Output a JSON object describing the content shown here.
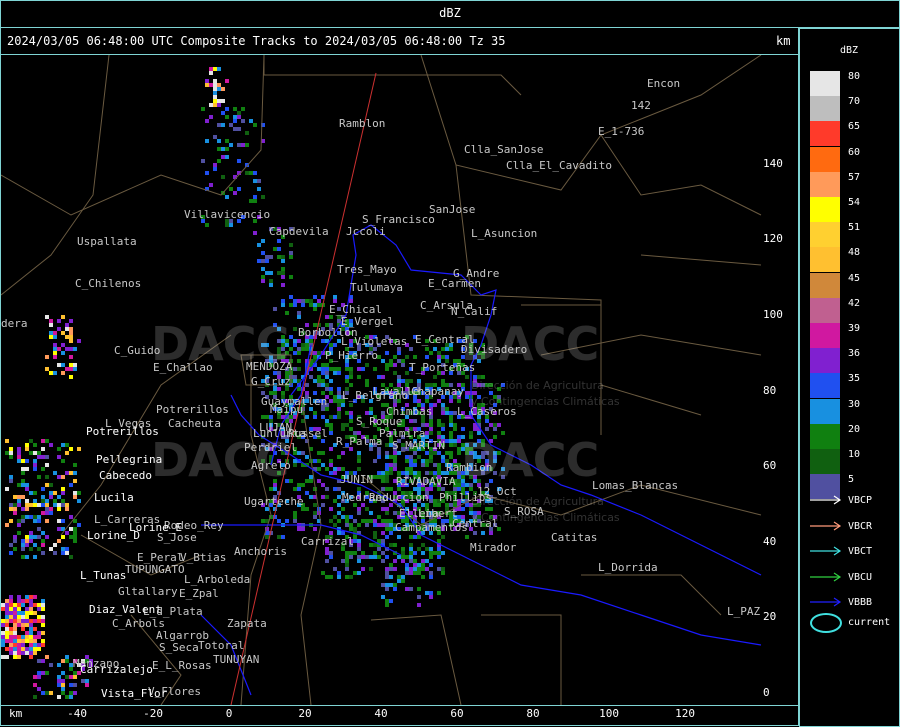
{
  "header": {
    "units": "dBZ"
  },
  "title_line": {
    "text": "2024/03/05 06:48:00 UTC Composite Tracks to 2024/03/05 06:48:00 Tz 35",
    "km": "km"
  },
  "axes": {
    "x_label": "km",
    "x_ticks": [
      "-40",
      "-20",
      "0",
      "20",
      "40",
      "60",
      "80",
      "100",
      "120"
    ],
    "y_ticks": [
      "140",
      "120",
      "100",
      "80",
      "60",
      "40",
      "20",
      "0"
    ],
    "x_range_km": [
      -60,
      140
    ],
    "y_range_km": [
      -20,
      150
    ]
  },
  "legend": {
    "title": "dBZ",
    "levels": [
      {
        "v": "80",
        "c": "#e6e6e6"
      },
      {
        "v": "70",
        "c": "#bebebe"
      },
      {
        "v": "65",
        "c": "#ff3a2a"
      },
      {
        "v": "60",
        "c": "#ff6a10"
      },
      {
        "v": "57",
        "c": "#ff9a5a"
      },
      {
        "v": "54",
        "c": "#ffff00"
      },
      {
        "v": "51",
        "c": "#ffd030"
      },
      {
        "v": "48",
        "c": "#ffc030"
      },
      {
        "v": "45",
        "c": "#d0883a"
      },
      {
        "v": "42",
        "c": "#c06090"
      },
      {
        "v": "39",
        "c": "#d018a0"
      },
      {
        "v": "36",
        "c": "#8020d0"
      },
      {
        "v": "35",
        "c": "#2050f0"
      },
      {
        "v": "30",
        "c": "#1890e0"
      },
      {
        "v": "20",
        "c": "#108010"
      },
      {
        "v": "10",
        "c": "#106010"
      },
      {
        "v": "5",
        "c": "#5050a0"
      }
    ],
    "tracks": [
      {
        "label": "VBCP",
        "c": "#ffffff"
      },
      {
        "label": "VBCR",
        "c": "#ff9a7a"
      },
      {
        "label": "VBCT",
        "c": "#40e0e0"
      },
      {
        "label": "VBCU",
        "c": "#30d040"
      },
      {
        "label": "VBBB",
        "c": "#2020ff"
      }
    ],
    "current_label": "current"
  },
  "watermark": {
    "logo": "DACC",
    "sub1": "Dirección de Agricultura",
    "sub2": "y Contingencias Climáticas"
  },
  "places_gray": [
    "Ramblon",
    "Encon",
    "E_1-736",
    "Clla_SanJose",
    "Clla_El_Cavadito",
    "Villavicencio",
    "SanJose",
    "Uspallata",
    "Capdevila",
    "Jccoli",
    "S_Francisco",
    "L_Asuncion",
    "Tres_Mayo",
    "G_Andre",
    "C_Chilenos",
    "Tulumaya",
    "E_Carmen",
    "E_Chical",
    "C_Arsula",
    "N_Calif",
    "Borbollon",
    "E_Vergel",
    "C_Guido",
    "L_Violetas",
    "E_Central",
    "Divisadero",
    "E_Challao",
    "P_Hierro",
    "T_Porteñas",
    "G_Cruz",
    "L_Vegas",
    "Potrerillos",
    "Cacheuta",
    "Chapanay",
    "L_Caseros",
    "Perdriel",
    "Chimbas",
    "S_Roque",
    "Lunlunta",
    "Agrelo",
    "S_MARTIN",
    "Palmira",
    "Rambion",
    "12_Oct",
    "Lomas_Blancas",
    "Ugarteche",
    "Medrano",
    "Phillips",
    "S_ROSA",
    "L_Carreras",
    "Rodeo_Rey",
    "Anchoris",
    "Carrizal",
    "Campamentos",
    "Central",
    "Catitas",
    "S_Jose",
    "E_Peral",
    "V_Btias",
    "Mirador",
    "TUPUNGATO",
    "L_Arboleda",
    "L_Dorrida",
    "Gltallary",
    "E_Zpal",
    "L_PAZ",
    "L_d_Plata",
    "C_Arbols",
    "Zapata",
    "Algarrob",
    "S_Seca",
    "Totoral",
    "Manzano",
    "E_L_Rosas",
    "TUNUYAN",
    "V_Flores",
    "MENDOZA",
    "LUJAN",
    "Russel",
    "RIVADAVIA",
    "JUNIN",
    "Libert",
    "Reduccion",
    "L_Belgrano",
    "Guaymallen",
    "Maipu",
    "Lavalle",
    "R_Palma",
    "Ellena",
    "dera",
    "142"
  ],
  "places_white": [
    "Potrerillos",
    "Pellegrina",
    "Cabecedo",
    "Lucila",
    "Lorine_E",
    "Lorine_D",
    "L_Tunas",
    "Diaz_Valent",
    "Carrizalejo",
    "Vista_Flor"
  ]
}
